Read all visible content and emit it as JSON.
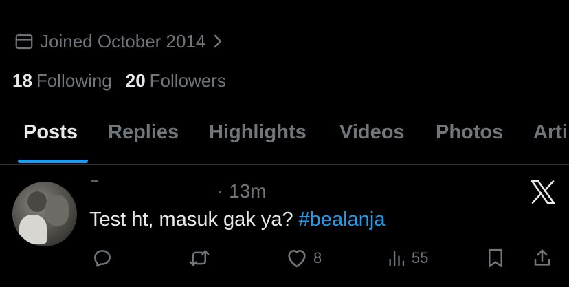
{
  "profile": {
    "joined": "Joined October 2014",
    "following_count": "18",
    "following_label": "Following",
    "followers_count": "20",
    "followers_label": "Followers"
  },
  "tabs": [
    {
      "label": "Posts",
      "active": true
    },
    {
      "label": "Replies"
    },
    {
      "label": "Highlights"
    },
    {
      "label": "Videos"
    },
    {
      "label": "Photos"
    },
    {
      "label": "Arti"
    }
  ],
  "post": {
    "time": "· 13m",
    "text_plain": "Test ht, masuk gak ya? ",
    "hashtag": "#bealanja",
    "likes": "8",
    "views": "55"
  },
  "icons": {
    "calendar": "calendar-icon",
    "chevron": "chevron-right-icon",
    "x_logo": "x-logo-icon",
    "reply": "reply-icon",
    "repost": "repost-icon",
    "like": "heart-icon",
    "views": "views-icon",
    "bookmark": "bookmark-icon",
    "share": "share-icon"
  },
  "colors": {
    "background": "#000000",
    "text_primary": "#e7e9ea",
    "text_secondary": "#71767b",
    "accent": "#1d9bf0",
    "divider": "#2f3336"
  }
}
